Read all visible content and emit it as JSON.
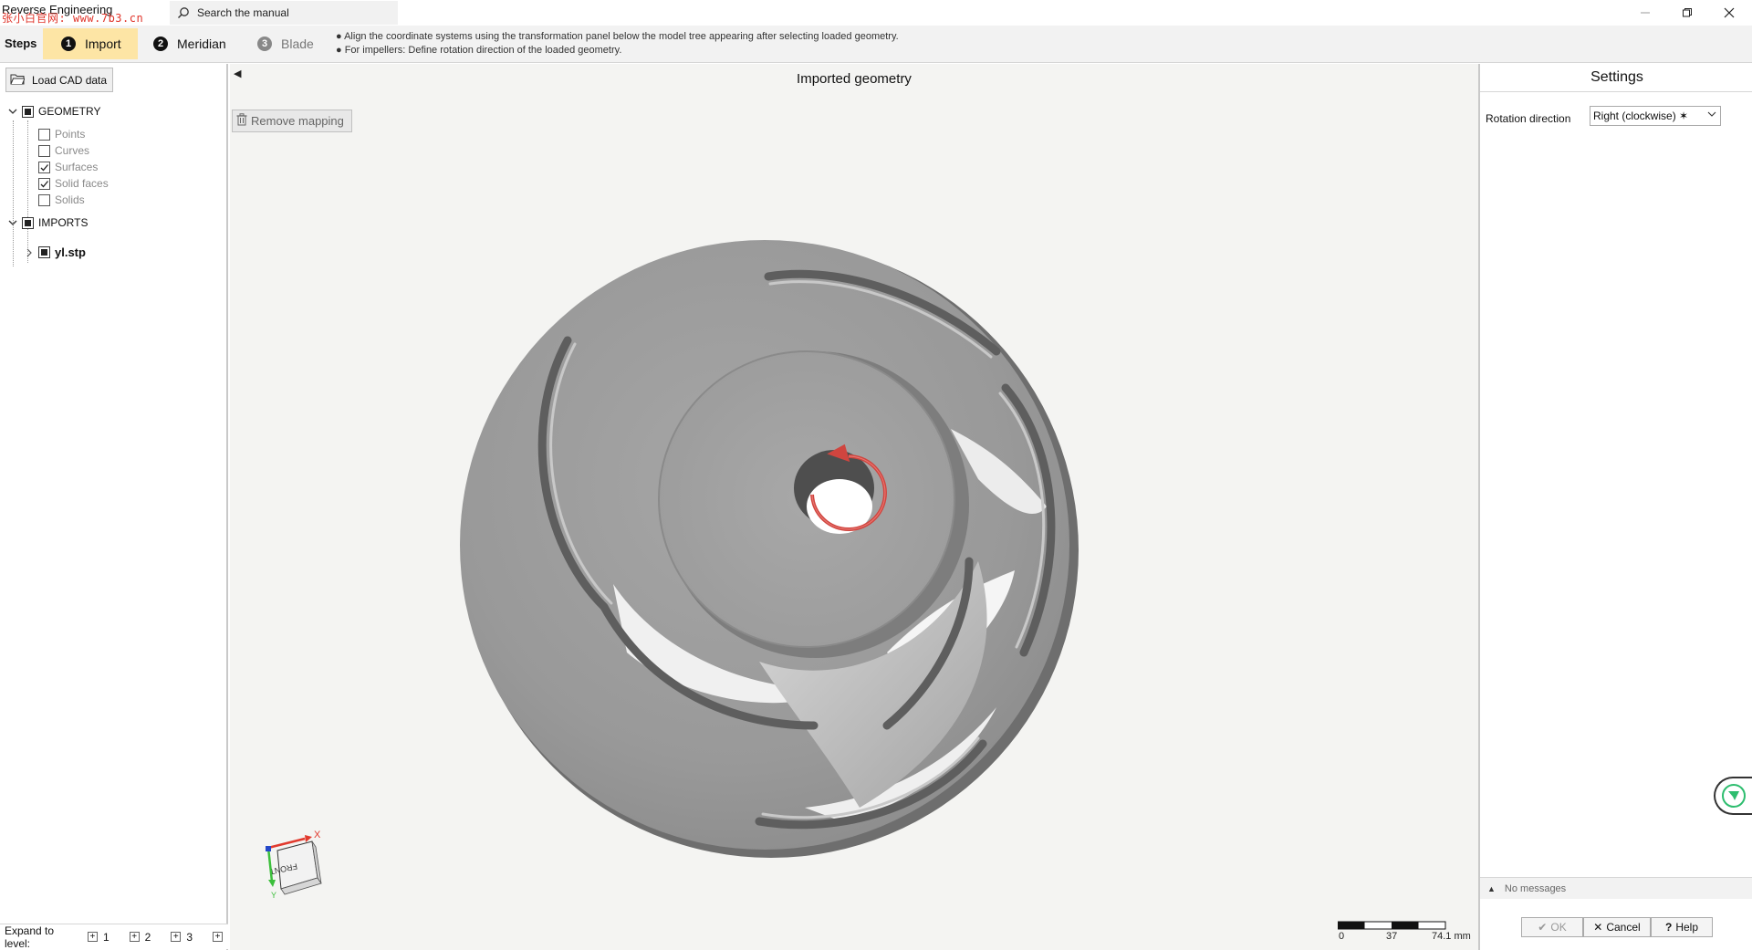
{
  "window": {
    "title": "Reverse Engineering",
    "watermark": "张小白官网: www.7b3.cn",
    "search_placeholder": "Search the manual"
  },
  "steps": {
    "label": "Steps",
    "items": [
      {
        "num": "1",
        "label": "Import",
        "state": "active"
      },
      {
        "num": "2",
        "label": "Meridian",
        "state": "enabled"
      },
      {
        "num": "3",
        "label": "Blade",
        "state": "disabled"
      }
    ],
    "hints": [
      "● Align the coordinate systems using the transformation panel below the model tree appearing after selecting loaded geometry.",
      "● For impellers: Define rotation direction of the loaded geometry."
    ]
  },
  "left_panel": {
    "load_button": "Load CAD data",
    "tree": {
      "geometry_label": "GEOMETRY",
      "geometry_children": [
        {
          "label": "Points",
          "checked": false
        },
        {
          "label": "Curves",
          "checked": false
        },
        {
          "label": "Surfaces",
          "checked": true
        },
        {
          "label": "Solid faces",
          "checked": true
        },
        {
          "label": "Solids",
          "checked": false
        }
      ],
      "imports_label": "IMPORTS",
      "import_file": "yl.stp"
    },
    "expand": {
      "label": "Expand to level:",
      "levels": [
        "1",
        "2",
        "3"
      ]
    }
  },
  "viewport": {
    "title": "Imported geometry",
    "remove_mapping": "Remove mapping",
    "axis_x": "X",
    "axis_y": "Y",
    "cube_face": "FRONT",
    "scale_labels": [
      "0",
      "37",
      "74.1 mm"
    ]
  },
  "right_panel": {
    "title": "Settings",
    "rotation_label": "Rotation direction",
    "rotation_value": "Right (clockwise) ✶",
    "messages": "No messages",
    "ok": "OK",
    "cancel": "Cancel",
    "help": "Help"
  },
  "colors": {
    "active_step": "#fde5a5",
    "rotation_arrow": "#d0453f",
    "impeller_face": "#9a9a9a"
  }
}
